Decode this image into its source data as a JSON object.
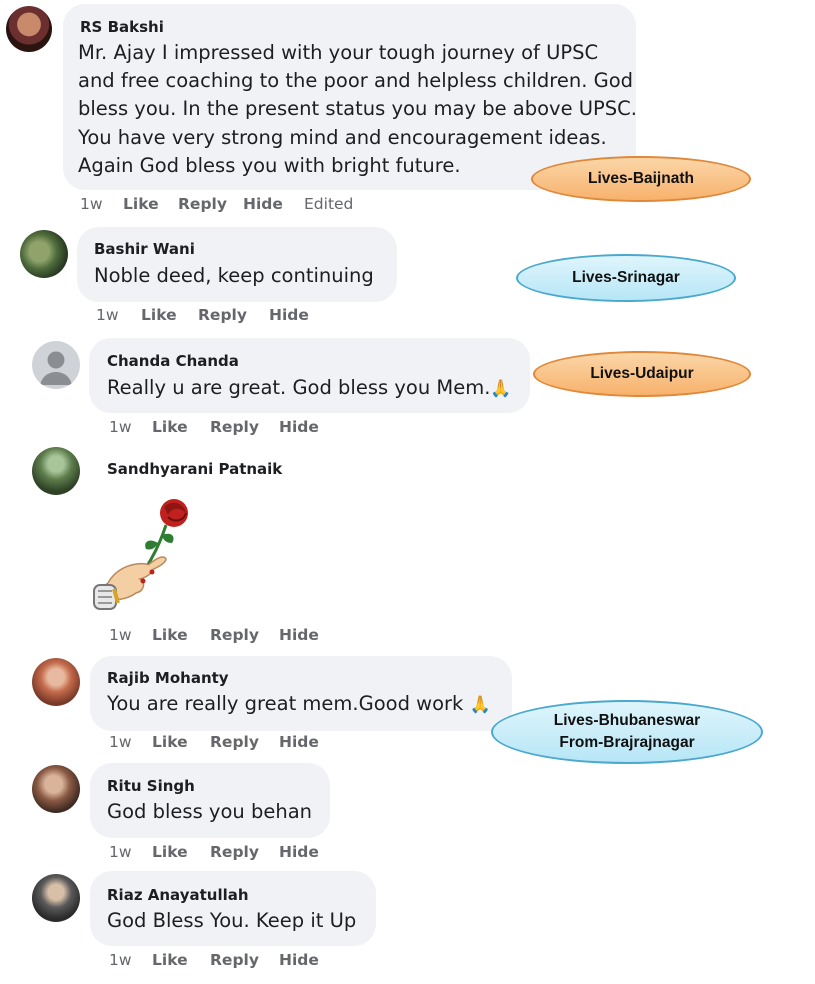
{
  "comments": [
    {
      "author": "RS Bakshi",
      "lines": [
        "Mr. Ajay I impressed with your tough journey of UPSC",
        "and free coaching to the poor and helpless children. God",
        "bless you. In the present status you may be above UPSC.",
        "You have very strong mind and encouragement ideas.",
        "Again God bless you with bright future."
      ],
      "time": "1w",
      "like": "Like",
      "reply": "Reply",
      "hide": "Hide",
      "edited": "Edited"
    },
    {
      "author": "Bashir Wani",
      "lines": [
        "Noble deed, keep continuing"
      ],
      "time": "1w",
      "like": "Like",
      "reply": "Reply",
      "hide": "Hide"
    },
    {
      "author": "Chanda Chanda",
      "lines": [
        "Really u are great. God bless you Mem."
      ],
      "emoji": "🙏",
      "time": "1w",
      "like": "Like",
      "reply": "Reply",
      "hide": "Hide"
    },
    {
      "author": "Sandhyarani Patnaik",
      "sticker": "hand-holding-rose-sticker",
      "time": "1w",
      "like": "Like",
      "reply": "Reply",
      "hide": "Hide"
    },
    {
      "author": "Rajib Mohanty",
      "lines": [
        "You are really great mem.Good work"
      ],
      "emoji": "🙏",
      "time": "1w",
      "like": "Like",
      "reply": "Reply",
      "hide": "Hide"
    },
    {
      "author": "Ritu Singh",
      "lines": [
        "God bless you behan"
      ],
      "time": "1w",
      "like": "Like",
      "reply": "Reply",
      "hide": "Hide"
    },
    {
      "author": "Riaz Anayatullah",
      "lines": [
        "God Bless You. Keep it Up"
      ],
      "time": "1w",
      "like": "Like",
      "reply": "Reply",
      "hide": "Hide"
    }
  ],
  "annotations": [
    {
      "lines": [
        "Lives-Baijnath"
      ],
      "style": "orange"
    },
    {
      "lines": [
        "Lives-Srinagar"
      ],
      "style": "blue"
    },
    {
      "lines": [
        "Lives-Udaipur"
      ],
      "style": "orange"
    },
    {
      "lines": [
        "Lives-Bhubaneswar",
        "From-Brajrajnagar"
      ],
      "style": "blue"
    }
  ],
  "colors": {
    "bubble": "#f0f2f5",
    "meta_text": "#65676b",
    "body_text": "#1c1e21",
    "annotation_orange": "#f7b26c",
    "annotation_blue": "#b7e6f6"
  }
}
